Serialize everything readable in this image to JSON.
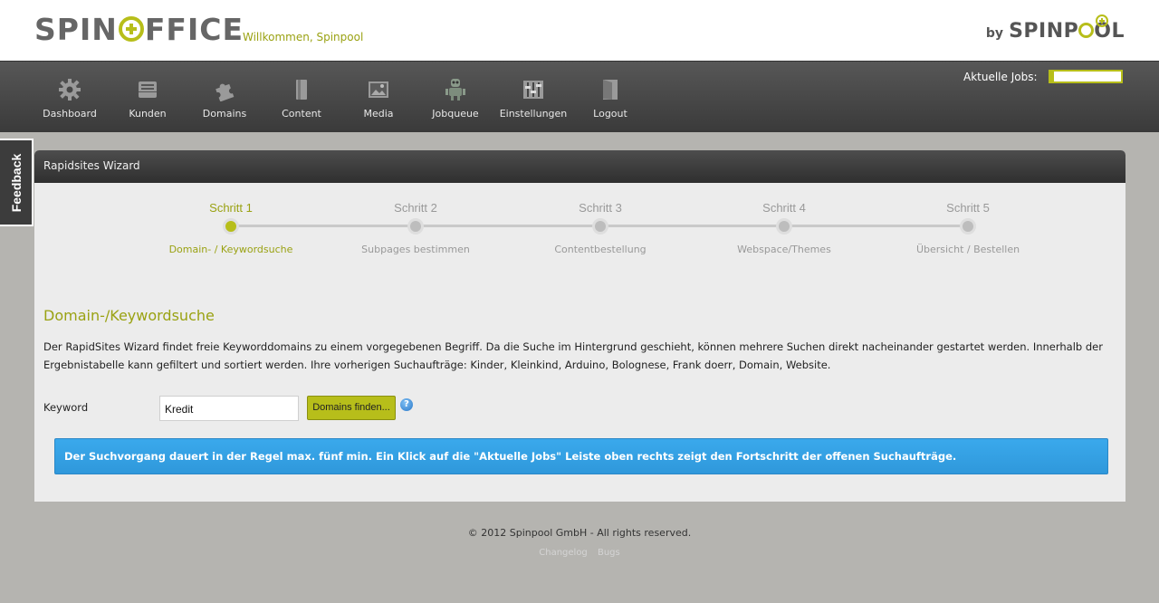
{
  "header": {
    "logo_text_left": "SPIN",
    "logo_text_right": "FFICE",
    "welcome": "Willkommen, Spinpool",
    "by_label": "by",
    "by_brand_left": "SPINP",
    "by_brand_right": "OL"
  },
  "nav": {
    "items": [
      {
        "label": "Dashboard",
        "icon": "gear-icon"
      },
      {
        "label": "Kunden",
        "icon": "inbox-icon"
      },
      {
        "label": "Domains",
        "icon": "puzzle-icon"
      },
      {
        "label": "Content",
        "icon": "document-icon"
      },
      {
        "label": "Media",
        "icon": "image-icon"
      },
      {
        "label": "Jobqueue",
        "icon": "robot-icon"
      },
      {
        "label": "Einstellungen",
        "icon": "sliders-icon"
      },
      {
        "label": "Logout",
        "icon": "door-icon"
      }
    ],
    "jobs_label": "Aktuelle Jobs:",
    "jobs_progress": 0.05
  },
  "feedback_label": "Feedback",
  "wizard": {
    "title": "Rapidsites Wizard",
    "steps": [
      {
        "name": "Schritt 1",
        "sub": "Domain- / Keywordsuche",
        "active": true
      },
      {
        "name": "Schritt 2",
        "sub": "Subpages bestimmen",
        "active": false
      },
      {
        "name": "Schritt 3",
        "sub": "Contentbestellung",
        "active": false
      },
      {
        "name": "Schritt 4",
        "sub": "Webspace/Themes",
        "active": false
      },
      {
        "name": "Schritt 5",
        "sub": "Übersicht / Bestellen",
        "active": false
      }
    ],
    "section_title": "Domain-/Keywordsuche",
    "description": "Der RapidSites Wizard findet freie Keyworddomains zu einem vorgegebenen Begriff. Da die Suche im Hintergrund geschieht, können mehrere Suchen direkt nacheinander gestartet werden. Innerhalb der Ergebnistabelle kann gefiltert und sortiert werden. Ihre vorherigen Suchaufträge: Kinder, Kleinkind, Arduino, Bolognese, Frank doerr, Domain, Website.",
    "keyword_label": "Keyword",
    "keyword_value": "Kredit",
    "find_button": "Domains finden...",
    "help": "?",
    "info": "Der Suchvorgang dauert in der Regel max. fünf min. Ein Klick auf die \"Aktuelle Jobs\" Leiste oben rechts zeigt den Fortschritt der offenen Suchaufträge."
  },
  "footer": {
    "copyright": "© 2012 Spinpool GmbH - All rights reserved.",
    "links": [
      "Changelog",
      "Bugs"
    ]
  },
  "colors": {
    "accent": "#b7be1a",
    "info": "#3aa9ec",
    "nav_bg": "#3a3a3a",
    "page_bg": "#b5b4b0"
  }
}
